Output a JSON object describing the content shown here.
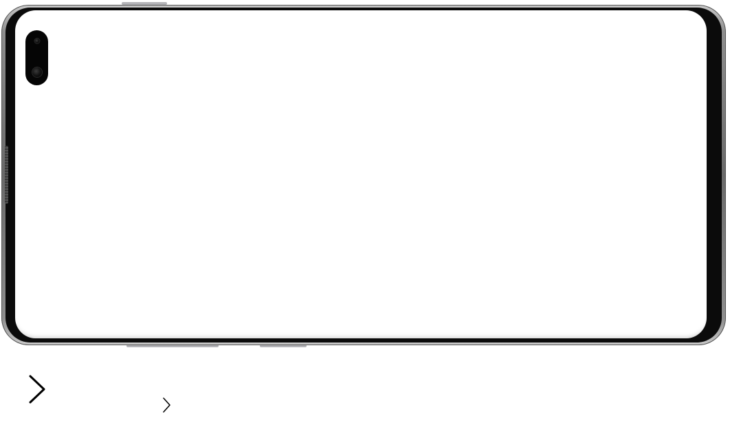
{
  "device": {
    "type": "phone-landscape-mockup",
    "frame_color": "#7a7a7a",
    "bezel_color": "#0b0b0b",
    "screen_color": "#ffffff",
    "camera": "dual-punch-hole"
  },
  "navigation": {
    "large_chevron_icon": "chevron-right-icon",
    "small_chevron_icon": "chevron-right-icon"
  }
}
